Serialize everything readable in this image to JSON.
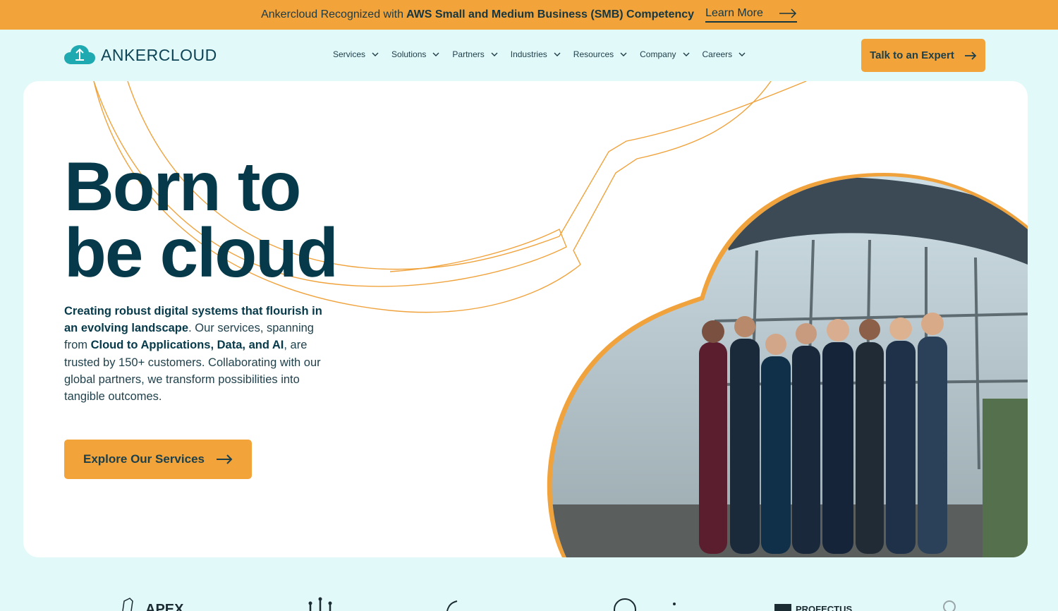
{
  "announcement": {
    "prefix": "Ankercloud Recognized with",
    "highlight": "AWS Small and Medium Business (SMB) Competency",
    "link_label": "Learn More"
  },
  "brand": {
    "name": "ANKERCLOUD",
    "accent": "#f2a33a",
    "primary": "#063a4a",
    "background": "#e2f9f9",
    "logo_icon": "cloud-upload-icon"
  },
  "nav": {
    "items": [
      {
        "label": "Services"
      },
      {
        "label": "Solutions"
      },
      {
        "label": "Partners"
      },
      {
        "label": "Industries"
      },
      {
        "label": "Resources"
      },
      {
        "label": "Company"
      },
      {
        "label": "Careers"
      }
    ],
    "cta_label": "Talk to an Expert"
  },
  "hero": {
    "title_line1": "Born to",
    "title_line2": "be cloud",
    "desc_bold1": "Creating robust digital systems that flourish in an evolving landscape",
    "desc_text1": ". Our services, spanning from ",
    "desc_bold2": "Cloud to Applications, Data, and AI",
    "desc_text2": ", are trusted by 150+ customers. Collaborating with our global partners, we transform possibilities into tangible outcomes.",
    "button_label": "Explore Our Services"
  },
  "partner_logos": {
    "items": [
      {
        "label": "APEX"
      },
      {
        "label": ""
      },
      {
        "label": ""
      },
      {
        "label": ""
      },
      {
        "label": "PROFECTUS"
      },
      {
        "label": ""
      }
    ]
  }
}
